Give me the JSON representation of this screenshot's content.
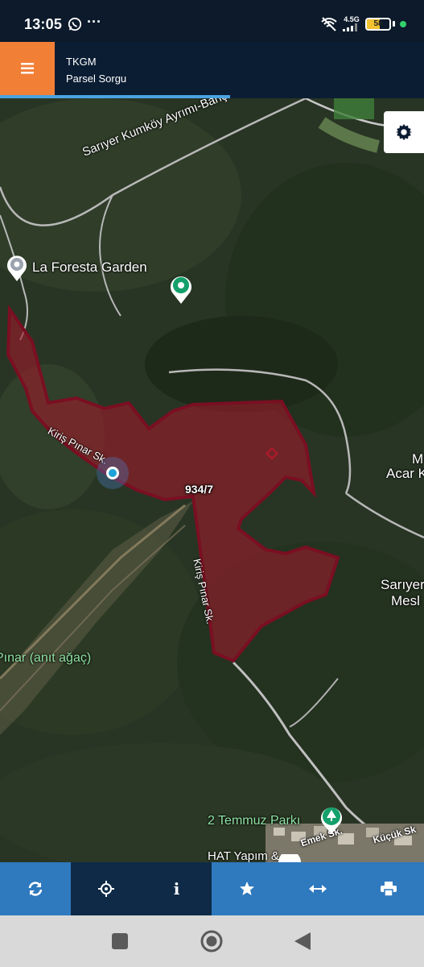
{
  "status_bar": {
    "time": "13:05",
    "more": "···",
    "network": "4.5G",
    "battery_level": 58,
    "battery_text": "58"
  },
  "app": {
    "title": "TKGM",
    "subtitle": "Parsel Sorgu",
    "accent_color": "#f27f36",
    "header_color": "#0b1d33"
  },
  "map": {
    "parcel": {
      "label": "934/7",
      "fill_color": "#9b1b2a",
      "stroke_color": "#7a0f22"
    },
    "labels": {
      "road_top": "Sarıyer Kumköy Ayrımı-Bahçeköy Yolu",
      "poi_garden": "La Foresta Garden",
      "road_left": "Kiriş Pınar Sk.",
      "road_vertical": "Kiriş Pınar Sk.",
      "tree": "Pınar (anıt ağaç)",
      "acar_1": "M",
      "acar_2": "Acar K",
      "sariyer_1": "Sarıyer",
      "sariyer_2": "Mesl",
      "park": "2 Temmuz Parkı",
      "emek": "Emek Sk.",
      "kucuk": "Küçük Sk",
      "hat": "HAT Yapım &"
    },
    "icons": {
      "settings": "gear-icon",
      "poi_pin": "map-pin-icon",
      "location": "current-location-icon",
      "park": "tree-icon"
    }
  },
  "toolbar": {
    "buttons": [
      {
        "name": "refresh",
        "icon": "refresh-icon"
      },
      {
        "name": "locate",
        "icon": "crosshair-icon"
      },
      {
        "name": "info",
        "icon": "info-icon",
        "text": "i"
      },
      {
        "name": "favorites",
        "icon": "star-icon"
      },
      {
        "name": "measure",
        "icon": "arrows-horizontal-icon"
      },
      {
        "name": "print",
        "icon": "print-icon"
      }
    ]
  },
  "nav": {
    "recent": "square-icon",
    "home": "circle-icon",
    "back": "triangle-back-icon"
  }
}
